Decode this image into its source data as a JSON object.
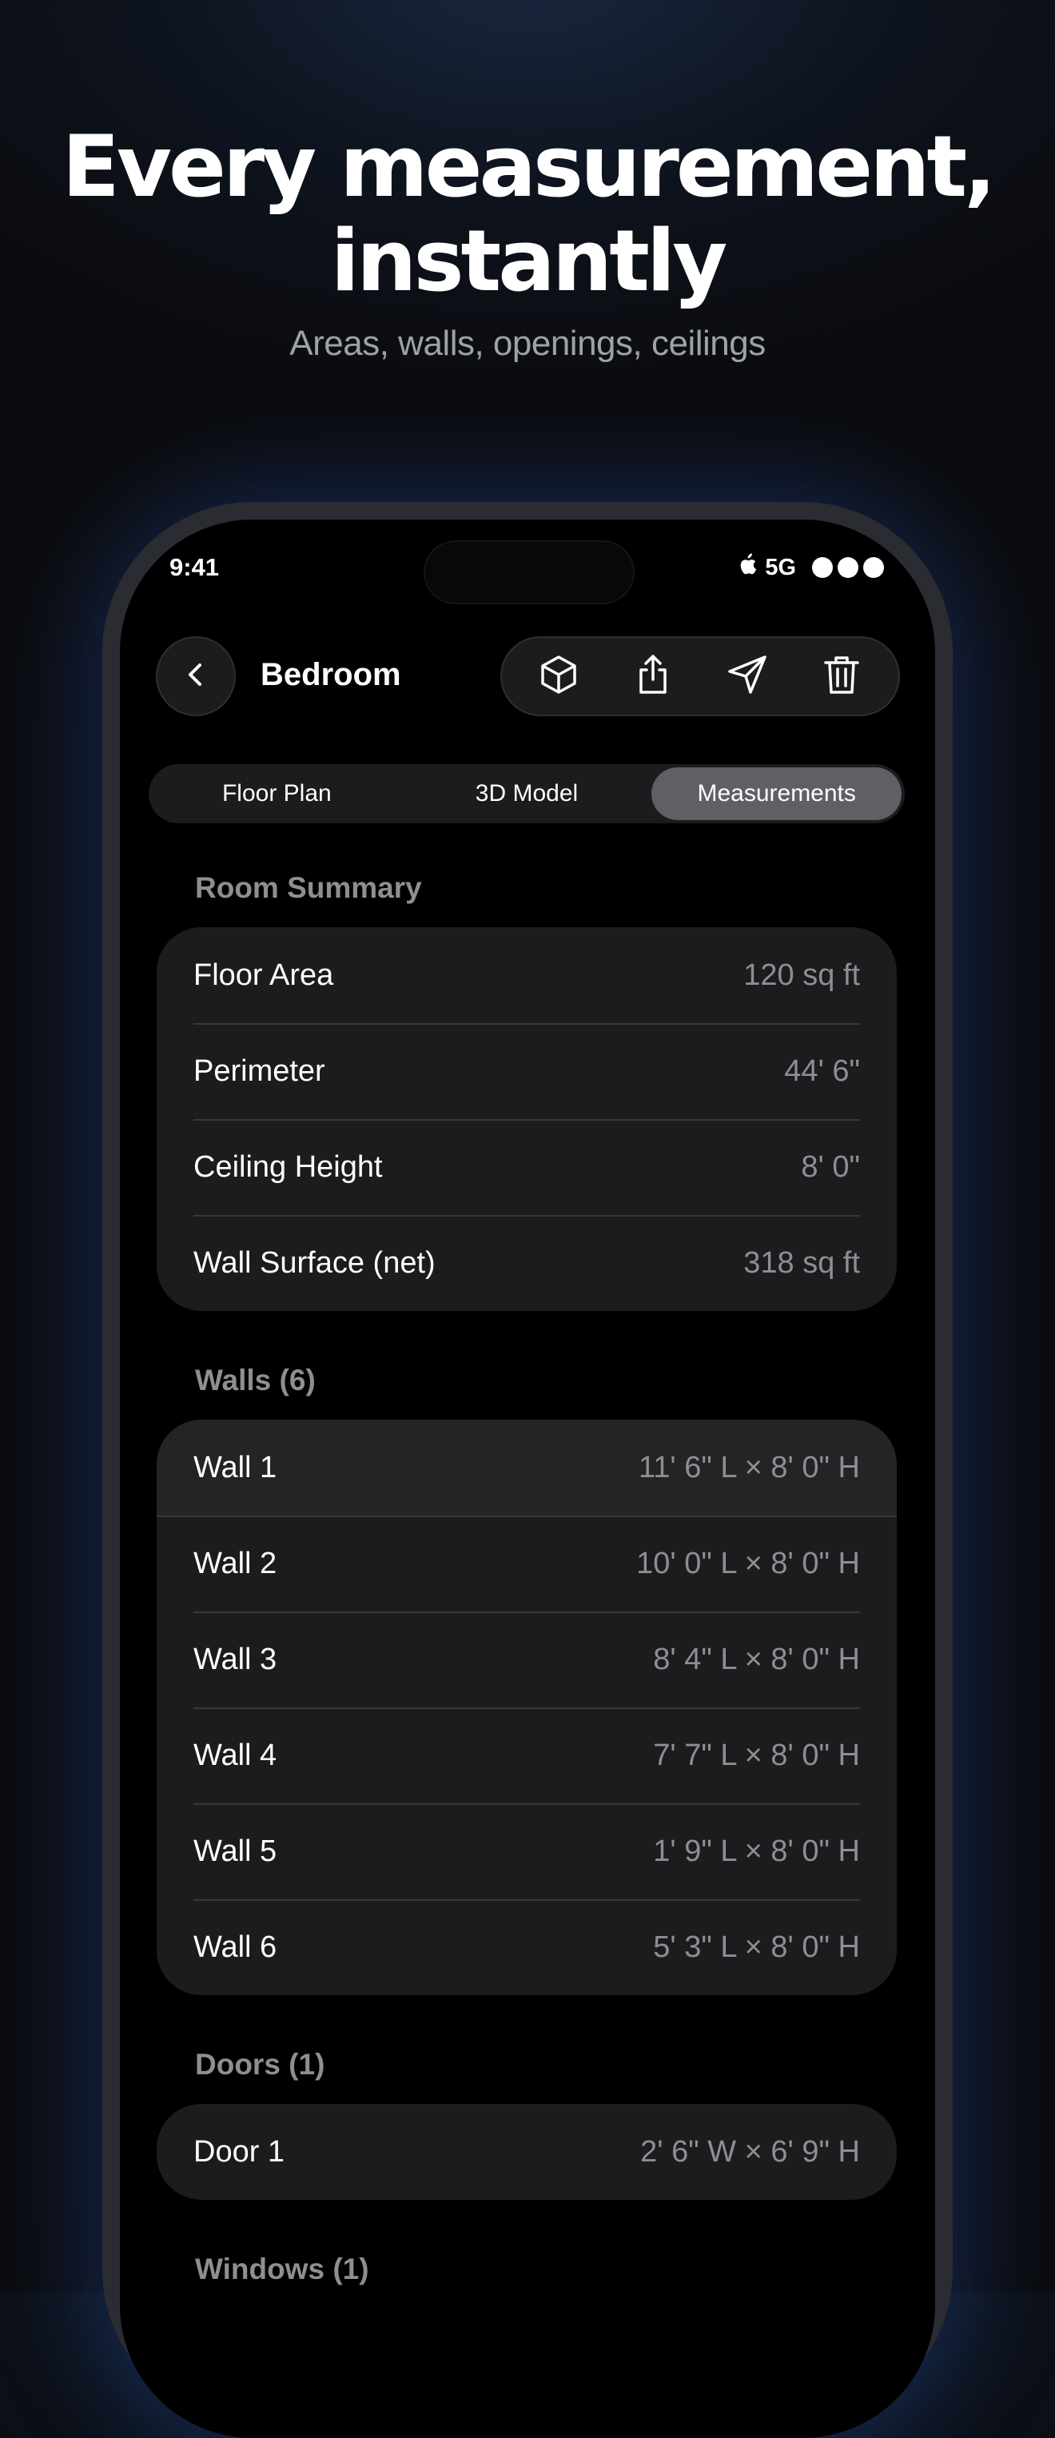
{
  "marketing": {
    "headline_line1": "Every measurement,",
    "headline_line2": "instantly",
    "subheadline": "Areas, walls, openings, ceilings"
  },
  "status_bar": {
    "time": "9:41",
    "network": "5G"
  },
  "nav": {
    "title": "Bedroom",
    "actions": [
      "cube-icon",
      "share-icon",
      "send-icon",
      "trash-icon"
    ]
  },
  "tabs": [
    {
      "label": "Floor Plan",
      "active": false
    },
    {
      "label": "3D Model",
      "active": false
    },
    {
      "label": "Measurements",
      "active": true
    }
  ],
  "room_summary": {
    "header": "Room Summary",
    "rows": [
      {
        "label": "Floor Area",
        "value": "120 sq ft"
      },
      {
        "label": "Perimeter",
        "value": "44' 6\""
      },
      {
        "label": "Ceiling Height",
        "value": "8' 0\""
      },
      {
        "label": "Wall Surface (net)",
        "value": "318 sq ft"
      }
    ]
  },
  "walls": {
    "header": "Walls (6)",
    "rows": [
      {
        "label": "Wall 1",
        "value": "11' 6\" L × 8' 0\" H"
      },
      {
        "label": "Wall 2",
        "value": "10' 0\" L × 8' 0\" H"
      },
      {
        "label": "Wall 3",
        "value": "8' 4\" L × 8' 0\" H"
      },
      {
        "label": "Wall 4",
        "value": "7' 7\" L × 8' 0\" H"
      },
      {
        "label": "Wall 5",
        "value": "1' 9\" L × 8' 0\" H"
      },
      {
        "label": "Wall 6",
        "value": "5' 3\" L × 8' 0\" H"
      }
    ]
  },
  "doors": {
    "header": "Doors (1)",
    "rows": [
      {
        "label": "Door 1",
        "value": "2' 6\" W × 6' 9\" H"
      }
    ]
  },
  "windows": {
    "header": "Windows (1)"
  },
  "colors": {
    "background": "#0b0c10",
    "card": "#1c1c1e",
    "secondary_text": "#8e8e93",
    "active_tab": "#5f5f65"
  }
}
